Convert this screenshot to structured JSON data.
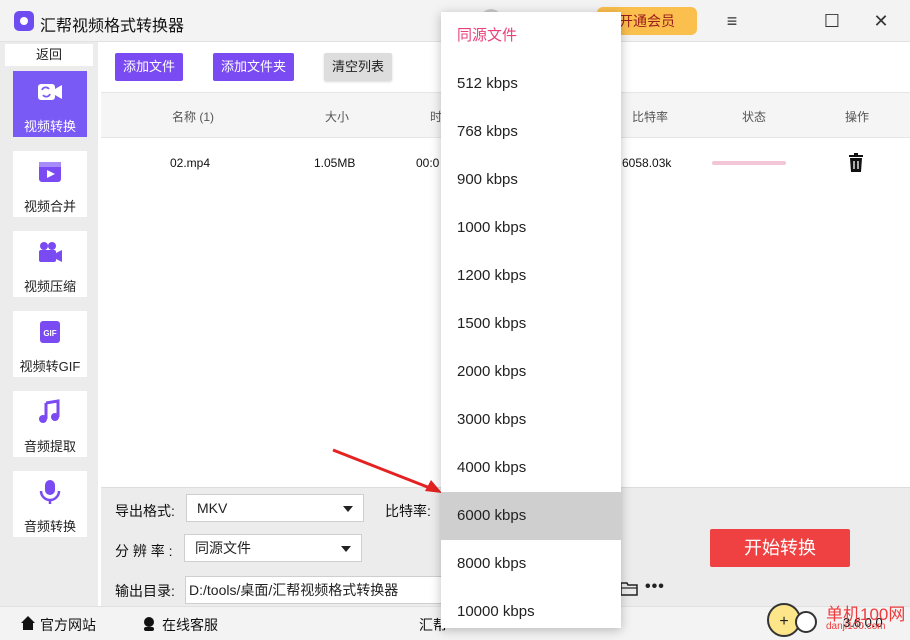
{
  "window": {
    "title": "汇帮视频格式转换器",
    "vip_label": "开通会员",
    "controls": {
      "menu": "≡",
      "maximize": "☐",
      "close": "✕"
    }
  },
  "sidebar": {
    "back_label": "返回",
    "items": [
      {
        "label": "视频转换",
        "icon": "video-convert-icon",
        "active": true
      },
      {
        "label": "视频合并",
        "icon": "video-merge-icon",
        "active": false
      },
      {
        "label": "视频压缩",
        "icon": "video-compress-icon",
        "active": false
      },
      {
        "label": "视频转GIF",
        "icon": "gif-icon",
        "active": false
      },
      {
        "label": "音频提取",
        "icon": "music-note-icon",
        "active": false
      },
      {
        "label": "音频转换",
        "icon": "microphone-icon",
        "active": false
      }
    ]
  },
  "toolbar": {
    "add_file": "添加文件",
    "add_folder": "添加文件夹",
    "clear_list": "清空列表"
  },
  "table": {
    "columns": [
      "名称 (1)",
      "大小",
      "时",
      "比特率",
      "状态",
      "操作"
    ],
    "rows": [
      {
        "name": "02.mp4",
        "size": "1.05MB",
        "duration": "00:0",
        "bitrate": "6058.03k",
        "status_progress": 0.0
      }
    ]
  },
  "settings": {
    "format_label": "导出格式:",
    "format_value": "MKV",
    "bitrate_label": "比特率:",
    "resolution_label": "分 辨 率 :",
    "resolution_value": "同源文件",
    "output_label": "输出目录:",
    "output_path": "D:/tools/桌面/汇帮视频格式转换器",
    "start_button": "开始转换"
  },
  "footer": {
    "website": "官方网站",
    "support": "在线客服",
    "center_text": "汇帮",
    "version": "3.6.0.0"
  },
  "watermark": {
    "site_name": "单机100网",
    "site_url": "danji100.com"
  },
  "bitrate_dropdown": {
    "options": [
      "同源文件",
      "512 kbps",
      "768 kbps",
      "900 kbps",
      "1000 kbps",
      "1200 kbps",
      "1500 kbps",
      "2000 kbps",
      "3000 kbps",
      "4000 kbps",
      "6000 kbps",
      "8000 kbps",
      "10000 kbps"
    ],
    "selected": "6000 kbps"
  },
  "colors": {
    "accent_purple": "#7a4af2",
    "start_red": "#ef4141",
    "vip_yellow": "#fbbf4d",
    "first_option_pink": "#e8407a"
  }
}
